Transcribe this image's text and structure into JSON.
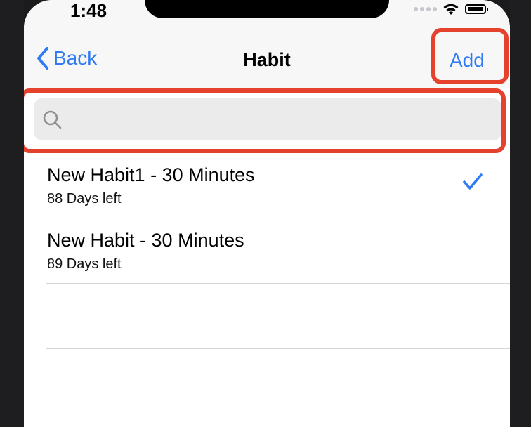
{
  "status_bar": {
    "time": "1:48"
  },
  "nav": {
    "back_label": "Back",
    "title": "Habit",
    "add_label": "Add"
  },
  "search": {
    "placeholder": "",
    "value": ""
  },
  "habits": [
    {
      "title": "New Habit1 - 30 Minutes",
      "subtitle": "88 Days left",
      "checked": true
    },
    {
      "title": "New Habit - 30 Minutes",
      "subtitle": "89 Days left",
      "checked": false
    }
  ],
  "colors": {
    "accent": "#2f7bf5",
    "highlight": "#e5422e"
  }
}
